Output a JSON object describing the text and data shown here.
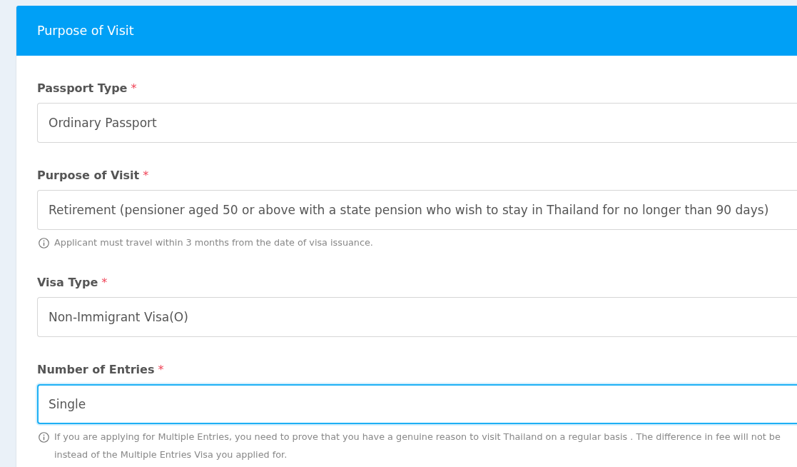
{
  "panel": {
    "title": "Purpose of Visit"
  },
  "fields": [
    {
      "label": "Passport Type",
      "required_mark": "*",
      "value": "Ordinary Passport",
      "focused": false
    },
    {
      "label": "Purpose of Visit",
      "required_mark": "*",
      "value": "Retirement (pensioner aged 50 or above with a state pension who wish to stay in Thailand for no longer than 90 days)",
      "focused": false,
      "help": [
        "Applicant must travel within 3 months from the date of visa issuance."
      ]
    },
    {
      "label": "Visa Type",
      "required_mark": "*",
      "value": "Non-Immigrant Visa(O)",
      "focused": false
    },
    {
      "label": "Number of Entries",
      "required_mark": "*",
      "value": "Single",
      "focused": true,
      "help": [
        "If you are applying for Multiple Entries, you need to prove that you have a genuine reason to visit Thailand on a regular basis . The difference in fee will not be",
        "instead of the Multiple Entries Visa you applied for."
      ]
    }
  ]
}
